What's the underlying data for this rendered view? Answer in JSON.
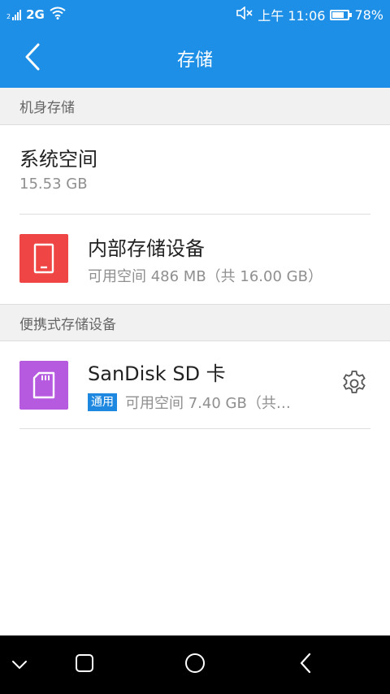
{
  "status_bar": {
    "sim_label": "2",
    "network": "2G",
    "time": "上午 11:06",
    "battery": "78%",
    "battery_level": 0.78,
    "icons": [
      "signal-icon",
      "wifi-icon",
      "mute-icon",
      "battery-icon"
    ]
  },
  "app_bar": {
    "title": "存储",
    "back_icon": "back-chevron-icon"
  },
  "sections": {
    "device_storage": {
      "label": "机身存储"
    },
    "portable_storage": {
      "label": "便携式存储设备"
    }
  },
  "system_space": {
    "title": "系统空间",
    "size": "15.53 GB"
  },
  "internal_storage": {
    "title": "内部存储设备",
    "subtitle": "可用空间 486 MB（共 16.00 GB）",
    "icon": "phone-icon",
    "icon_color": "#f04545"
  },
  "sd_card": {
    "title": "SanDisk SD 卡",
    "badge": "通用",
    "subtitle": "可用空间 7.40 GB（共…",
    "icon": "sd-card-icon",
    "icon_color": "#b65adf",
    "settings_icon": "gear-icon"
  },
  "nav_bar": {
    "buttons": [
      "chevron-down-icon",
      "square-icon",
      "circle-icon",
      "back-triangle-icon"
    ]
  },
  "colors": {
    "accent": "#1e8fe6",
    "badge": "#1e88e0"
  }
}
